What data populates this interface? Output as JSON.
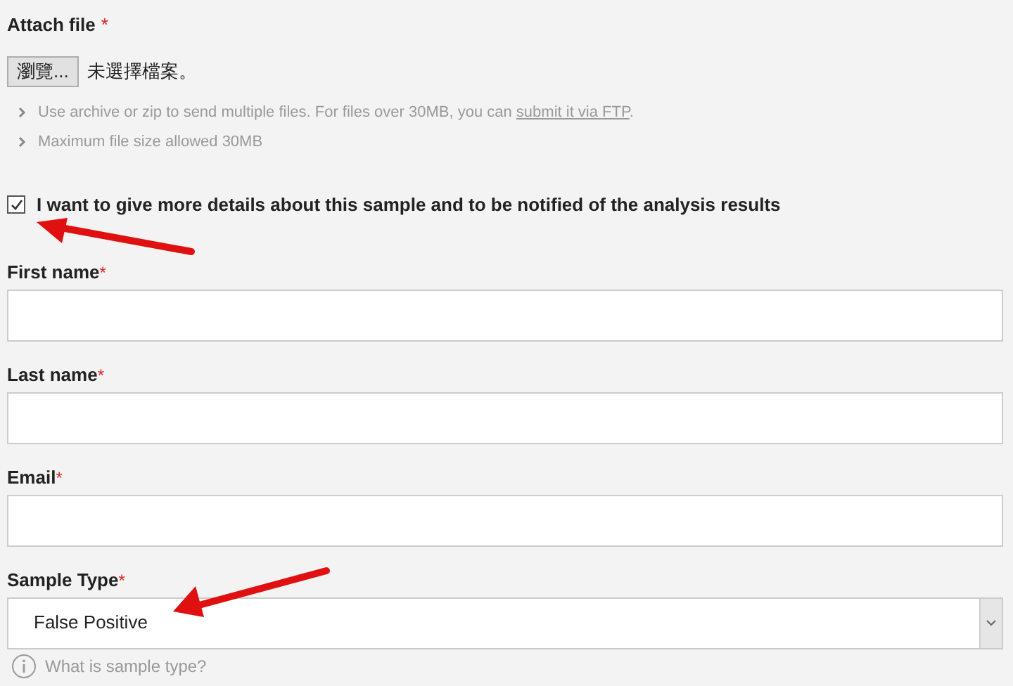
{
  "attach": {
    "label": "Attach file",
    "required_mark": "*",
    "browse_button": "瀏覽...",
    "file_status": "未選擇檔案。"
  },
  "hints": [
    {
      "text": "Use archive or zip to send multiple files. For files over 30MB, you can ",
      "link": "submit it via FTP",
      "after": "."
    },
    {
      "text": "Maximum file size allowed 30MB"
    }
  ],
  "details_checkbox": {
    "label": "I want to give more details about this sample and to be notified of the analysis results",
    "checked": true
  },
  "fields": [
    {
      "label": "First name",
      "required_mark": "*",
      "kind": "text"
    },
    {
      "label": "Last name",
      "required_mark": "*",
      "kind": "text"
    },
    {
      "label": "Email",
      "required_mark": "*",
      "kind": "text"
    },
    {
      "label": "Sample Type",
      "required_mark": "*",
      "kind": "select",
      "value": "False Positive"
    }
  ],
  "help_link": "What is sample type?"
}
